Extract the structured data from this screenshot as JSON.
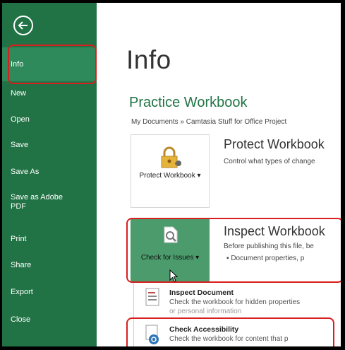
{
  "sidebar": {
    "items": [
      {
        "label": "Info"
      },
      {
        "label": "New"
      },
      {
        "label": "Open"
      },
      {
        "label": "Save"
      },
      {
        "label": "Save As"
      },
      {
        "label": "Save as Adobe PDF"
      },
      {
        "label": "Print"
      },
      {
        "label": "Share"
      },
      {
        "label": "Export"
      },
      {
        "label": "Close"
      }
    ],
    "active_item": "Info"
  },
  "main": {
    "title": "Info",
    "workbook_name": "Practice Workbook",
    "path": "My Documents » Camtasia Stuff for Office Project",
    "protect": {
      "button_label": "Protect Workbook ▾",
      "title": "Protect Workbook",
      "description": "Control what types of change"
    },
    "inspect": {
      "button_label": "Check for Issues ▾",
      "title": "Inspect Workbook",
      "description": "Before publishing this file, be",
      "bullet": "▪   Document properties, p"
    }
  },
  "dropdown": {
    "items": [
      {
        "title": "Inspect Document",
        "description": "Check the workbook for hidden properties",
        "description2": "or personal information"
      },
      {
        "title": "Check Accessibility",
        "description": "Check the workbook for content that p"
      }
    ]
  },
  "colors": {
    "sidebar_green": "#217346",
    "active_green": "#2e8a5a",
    "highlight_red": "#d81e1e",
    "heading_green": "#217346"
  }
}
